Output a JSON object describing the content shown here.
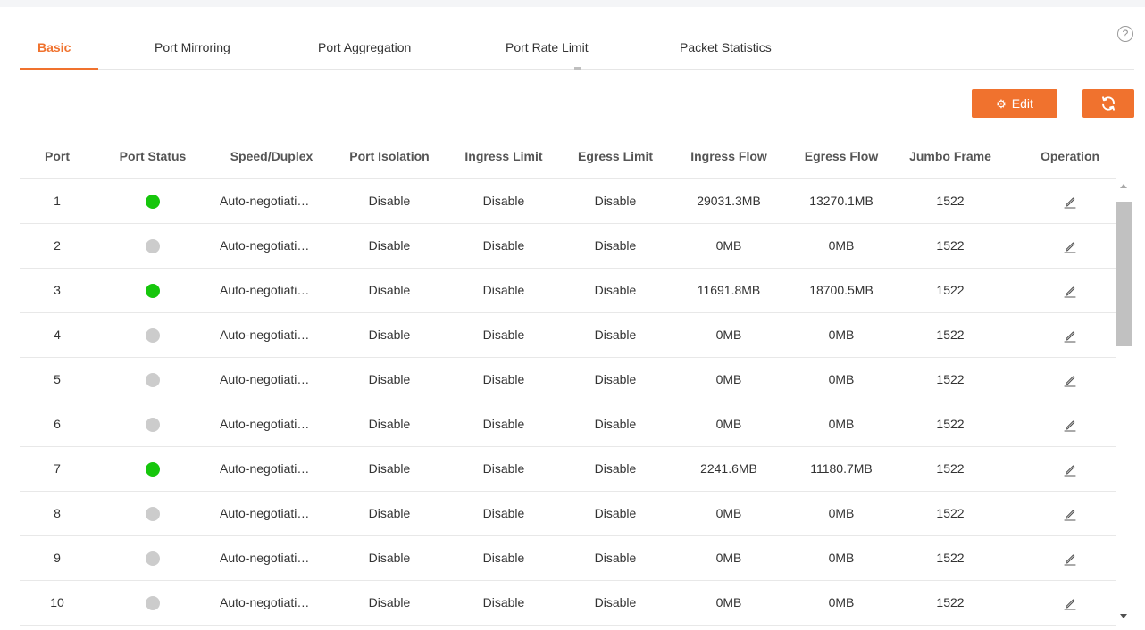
{
  "colors": {
    "accent": "#f0722e",
    "status_up": "#16c60c",
    "status_down": "#cccccc"
  },
  "tabs": [
    {
      "label": "Basic",
      "active": true
    },
    {
      "label": "Port Mirroring",
      "active": false
    },
    {
      "label": "Port Aggregation",
      "active": false
    },
    {
      "label": "Port Rate Limit",
      "active": false
    },
    {
      "label": "Packet Statistics",
      "active": false
    }
  ],
  "help": {
    "icon": "help-icon",
    "glyph": "?"
  },
  "toolbar": {
    "edit_label": "Edit",
    "edit_icon": "gear-icon",
    "edit_glyph": "⚙",
    "refresh_icon": "refresh-icon"
  },
  "table": {
    "columns": [
      "Port",
      "Port Status",
      "Speed/Duplex",
      "Port Isolation",
      "Ingress Limit",
      "Egress Limit",
      "Ingress Flow",
      "Egress Flow",
      "Jumbo Frame",
      "Operation"
    ],
    "rows": [
      {
        "port": "1",
        "status": "up",
        "speed": "Auto-negotiation",
        "isolation": "Disable",
        "ingress_limit": "Disable",
        "egress_limit": "Disable",
        "ingress_flow": "29031.3MB",
        "egress_flow": "13270.1MB",
        "jumbo": "1522"
      },
      {
        "port": "2",
        "status": "down",
        "speed": "Auto-negotiation",
        "isolation": "Disable",
        "ingress_limit": "Disable",
        "egress_limit": "Disable",
        "ingress_flow": "0MB",
        "egress_flow": "0MB",
        "jumbo": "1522"
      },
      {
        "port": "3",
        "status": "up",
        "speed": "Auto-negotiation",
        "isolation": "Disable",
        "ingress_limit": "Disable",
        "egress_limit": "Disable",
        "ingress_flow": "11691.8MB",
        "egress_flow": "18700.5MB",
        "jumbo": "1522"
      },
      {
        "port": "4",
        "status": "down",
        "speed": "Auto-negotiation",
        "isolation": "Disable",
        "ingress_limit": "Disable",
        "egress_limit": "Disable",
        "ingress_flow": "0MB",
        "egress_flow": "0MB",
        "jumbo": "1522"
      },
      {
        "port": "5",
        "status": "down",
        "speed": "Auto-negotiation",
        "isolation": "Disable",
        "ingress_limit": "Disable",
        "egress_limit": "Disable",
        "ingress_flow": "0MB",
        "egress_flow": "0MB",
        "jumbo": "1522"
      },
      {
        "port": "6",
        "status": "down",
        "speed": "Auto-negotiation",
        "isolation": "Disable",
        "ingress_limit": "Disable",
        "egress_limit": "Disable",
        "ingress_flow": "0MB",
        "egress_flow": "0MB",
        "jumbo": "1522"
      },
      {
        "port": "7",
        "status": "up",
        "speed": "Auto-negotiation",
        "isolation": "Disable",
        "ingress_limit": "Disable",
        "egress_limit": "Disable",
        "ingress_flow": "2241.6MB",
        "egress_flow": "11180.7MB",
        "jumbo": "1522"
      },
      {
        "port": "8",
        "status": "down",
        "speed": "Auto-negotiation",
        "isolation": "Disable",
        "ingress_limit": "Disable",
        "egress_limit": "Disable",
        "ingress_flow": "0MB",
        "egress_flow": "0MB",
        "jumbo": "1522"
      },
      {
        "port": "9",
        "status": "down",
        "speed": "Auto-negotiation",
        "isolation": "Disable",
        "ingress_limit": "Disable",
        "egress_limit": "Disable",
        "ingress_flow": "0MB",
        "egress_flow": "0MB",
        "jumbo": "1522"
      },
      {
        "port": "10",
        "status": "down",
        "speed": "Auto-negotiation",
        "isolation": "Disable",
        "ingress_limit": "Disable",
        "egress_limit": "Disable",
        "ingress_flow": "0MB",
        "egress_flow": "0MB",
        "jumbo": "1522"
      }
    ]
  }
}
